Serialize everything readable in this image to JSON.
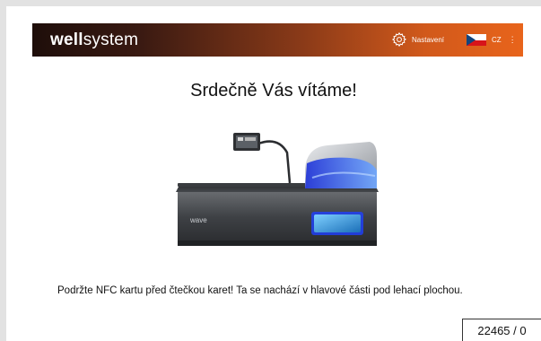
{
  "header": {
    "brand_bold": "well",
    "brand_light": "system",
    "settings_label": "Nastavení",
    "language_code": "CZ",
    "menu_glyph": "⋮",
    "colors": {
      "gradient_start": "#1e0e0a",
      "gradient_end": "#e8641b"
    }
  },
  "icons": {
    "settings": "gear-icon",
    "language": "czech-flag-icon",
    "menu": "kebab-menu-icon"
  },
  "main": {
    "title": "Srdečně Vás vítáme!",
    "product_logo": "wave",
    "instruction": "Podržte NFC kartu před čtečkou karet! Ta se nachází v hlavové části pod lehací plochou."
  },
  "footer": {
    "counter": "22465 / 0"
  }
}
